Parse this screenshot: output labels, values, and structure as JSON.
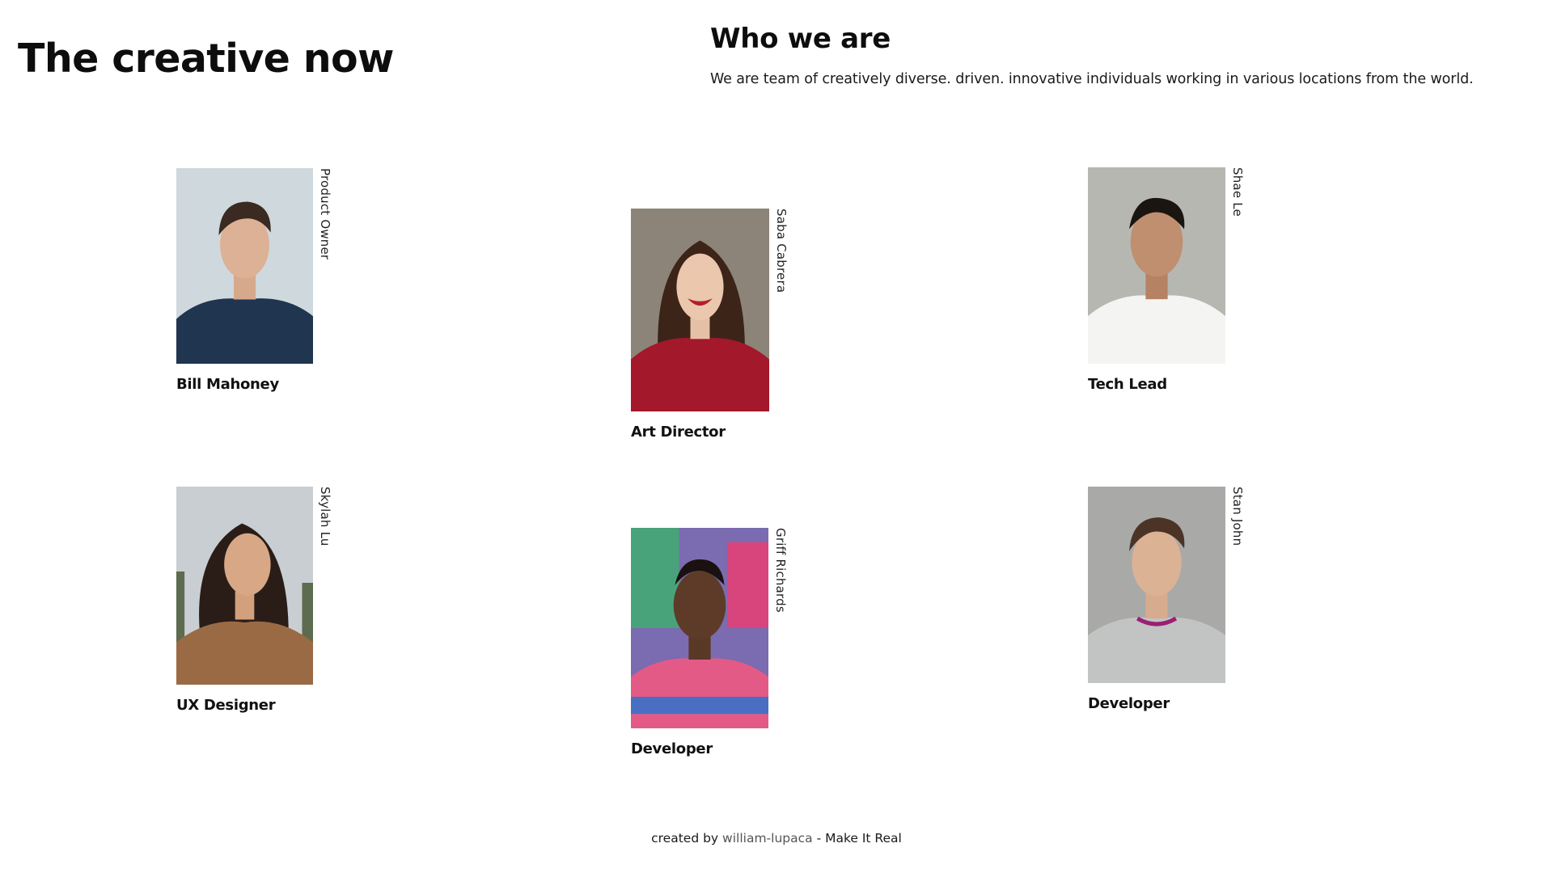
{
  "header": {
    "title": "The creative now"
  },
  "about": {
    "heading": "Who we are",
    "text": "We are team of creatively diverse. driven. innovative individuals working in various locations from the world."
  },
  "team": [
    {
      "name": "Product Owner",
      "role": "Bill Mahoney"
    },
    {
      "name": "Saba Cabrera",
      "role": "Art Director"
    },
    {
      "name": "Shae Le",
      "role": "Tech Lead"
    },
    {
      "name": "Skylah Lu",
      "role": "UX Designer"
    },
    {
      "name": "Griff Richards",
      "role": "Developer"
    },
    {
      "name": "Stan John",
      "role": "Developer"
    }
  ],
  "footer": {
    "prefix": "created by",
    "author": "william-lupaca",
    "suffix": "- Make It Real"
  }
}
